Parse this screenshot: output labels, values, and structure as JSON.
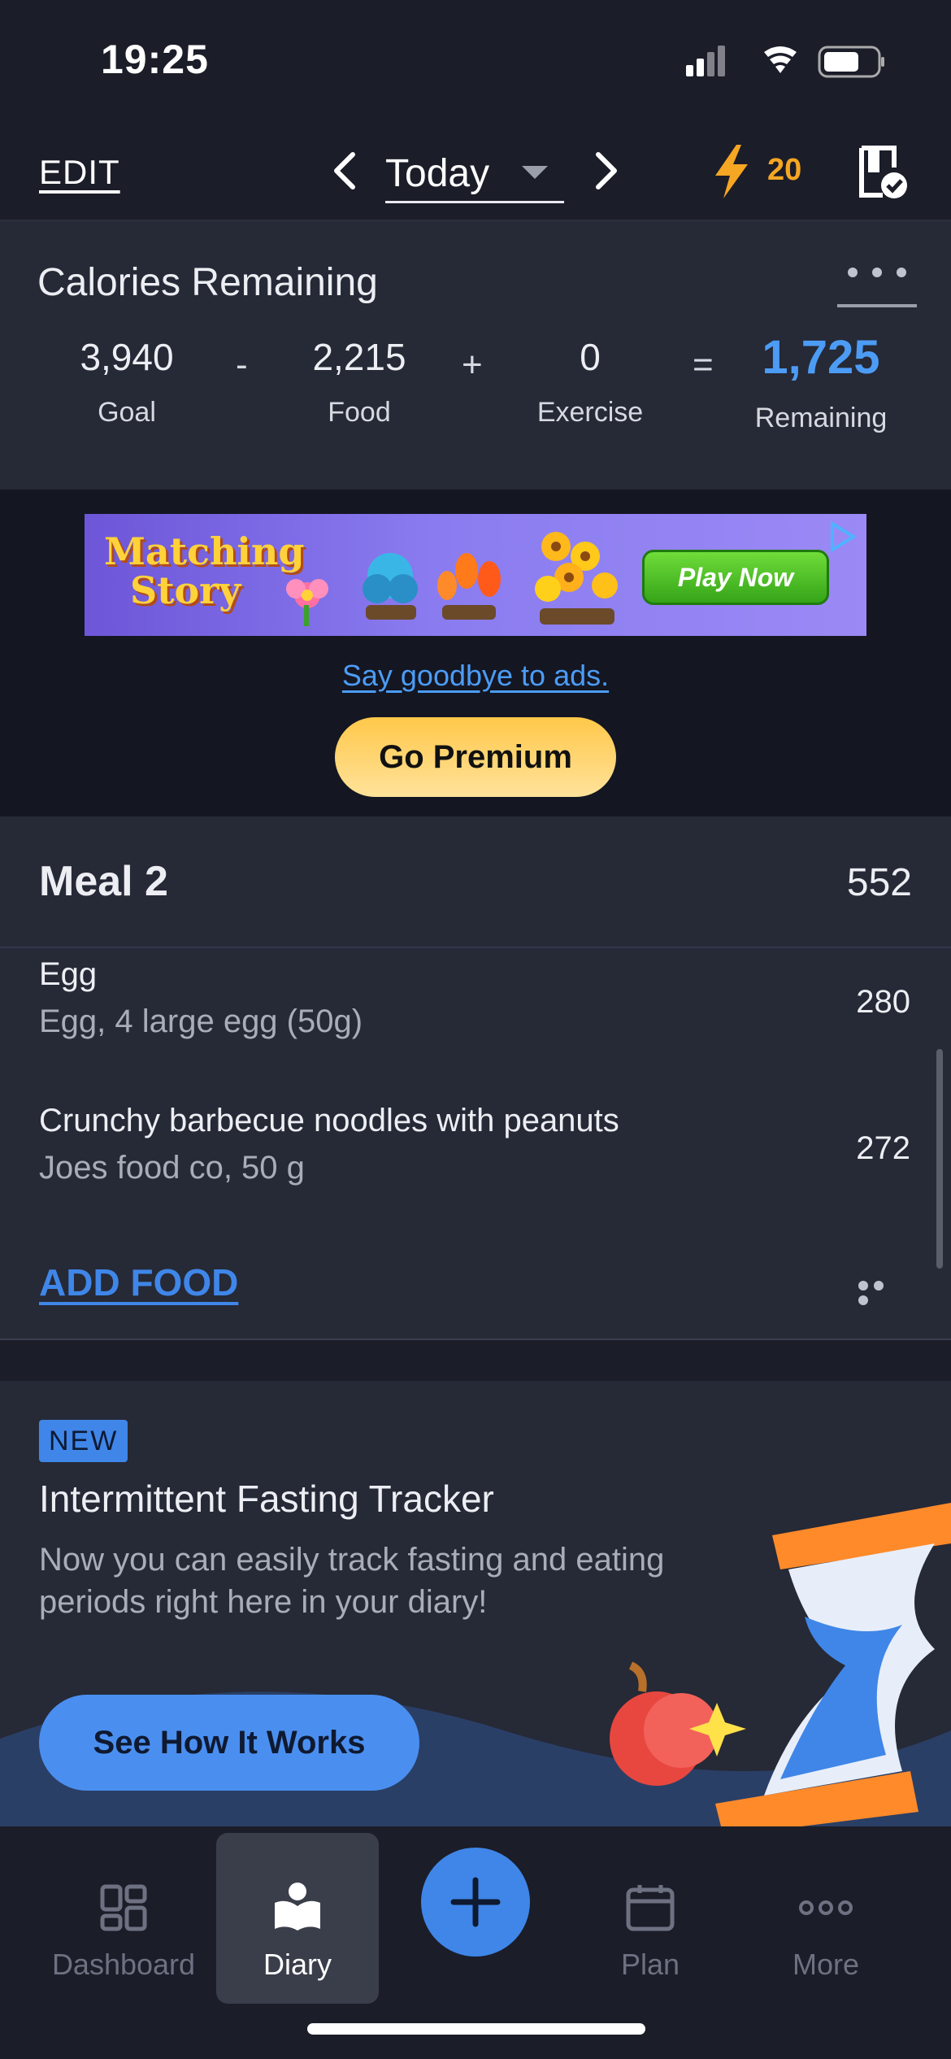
{
  "status": {
    "time": "19:25"
  },
  "topnav": {
    "edit": "EDIT",
    "date": "Today",
    "streak": "20"
  },
  "calories": {
    "title": "Calories Remaining",
    "goal": "3,940",
    "goal_label": "Goal",
    "op_minus": "-",
    "food": "2,215",
    "food_label": "Food",
    "op_plus": "+",
    "exercise": "0",
    "exercise_label": "Exercise",
    "op_equals": "=",
    "remaining": "1,725",
    "remaining_label": "Remaining"
  },
  "ad": {
    "brand_line1": "Matching",
    "brand_line2": "Story",
    "cta": "Play Now",
    "goodbye": "Say goodbye to ads.",
    "premium": "Go Premium"
  },
  "meal": {
    "title": "Meal 2",
    "total": "552",
    "items": [
      {
        "name": "Egg",
        "desc": "Egg, 4 large egg (50g)",
        "cal": "280"
      },
      {
        "name": "Crunchy barbecue noodles with peanuts",
        "desc": "Joes  food co, 50 g",
        "cal": "272"
      }
    ],
    "add_food": "ADD FOOD"
  },
  "fasting": {
    "badge": "NEW",
    "title": "Intermittent Fasting Tracker",
    "desc": "Now you can easily track fasting and eating periods right here in your diary!",
    "cta": "See How It Works"
  },
  "tabs": {
    "dashboard": "Dashboard",
    "diary": "Diary",
    "plan": "Plan",
    "more": "More"
  },
  "colors": {
    "accent": "#4c9cf5",
    "streak": "#f5a623",
    "premium": "#ffc84a",
    "background": "#1b1d29",
    "card": "#262936"
  }
}
